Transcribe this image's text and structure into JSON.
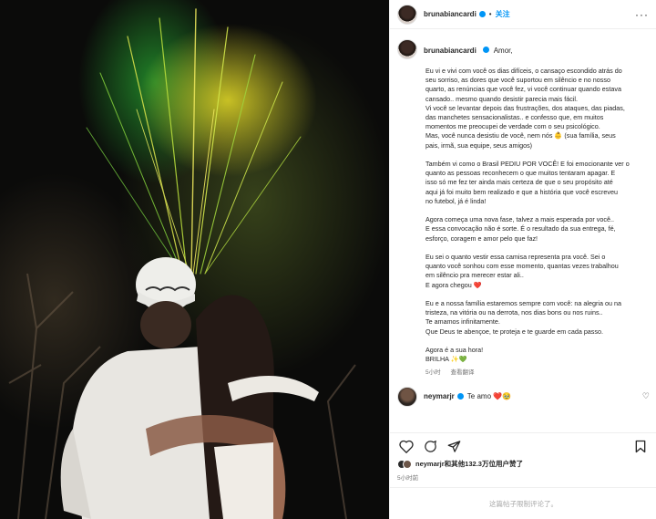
{
  "post": {
    "author": "brunabiancardi",
    "follow_label": "关注",
    "more_label": "···"
  },
  "caption": {
    "first_line": "Amor,",
    "body": "Eu vi e vivi com você os dias difíceis, o cansaço escondido atrás do\nseu sorriso, as dores que você suportou em silêncio e no nosso\nquarto, as renúncias que você fez, vi você continuar quando estava\ncansado.. mesmo quando desistir parecia mais fácil.\nVi você se levantar depois das frustrações, dos ataques, das piadas,\ndas manchetes sensacionalistas.. e confesso que, em muitos\nmomentos me preocupei de verdade com o seu psicológico.\nMas, você nunca desistiu de você, nem nós 👶 (sua família, seus\npais, irmã, sua equipe, seus amigos)\n\nTambém vi como o Brasil PEDIU POR VOCÊ! E foi emocionante ver o\nquanto as pessoas reconhecem o que muitos tentaram apagar. E\nisso só me fez ter ainda mais certeza de que o seu propósito até\naqui já foi muito bem realizado e que a história que você escreveu\nno futebol, já é linda!\n\nAgora começa uma nova fase, talvez a mais esperada por você..\nE essa convocação não é sorte. É o resultado da sua entrega, fé,\nesforço, coragem e amor pelo que faz!\n\nEu sei o quanto vestir essa camisa representa pra você. Sei o\nquanto você sonhou com esse momento, quantas vezes trabalhou\nem silêncio pra merecer estar ali..\nE agora chegou ❤️\n\nEu e a nossa família estaremos sempre com você: na alegria ou na\ntristeza, na vitória ou na derrota, nos dias bons ou nos ruins..\nTe amamos infinitamente.\nQue Deus te abençoe, te proteja e te guarde em cada passo.\n\nAgora é a sua hora!\nBRILHA ✨💚",
    "time": "5小时",
    "translate_label": "查看翻译"
  },
  "comment": {
    "user": "neymarjr",
    "text": "Te amo ❤️🥹"
  },
  "likes": {
    "text": "neymarjr和其他132.3万位用户赞了",
    "time": "5小时前"
  },
  "comments_closed": "这篇帖子限制评论了。",
  "colors": {
    "accent": "#0095f6",
    "heart": "#ed4956",
    "muted": "#737373"
  }
}
